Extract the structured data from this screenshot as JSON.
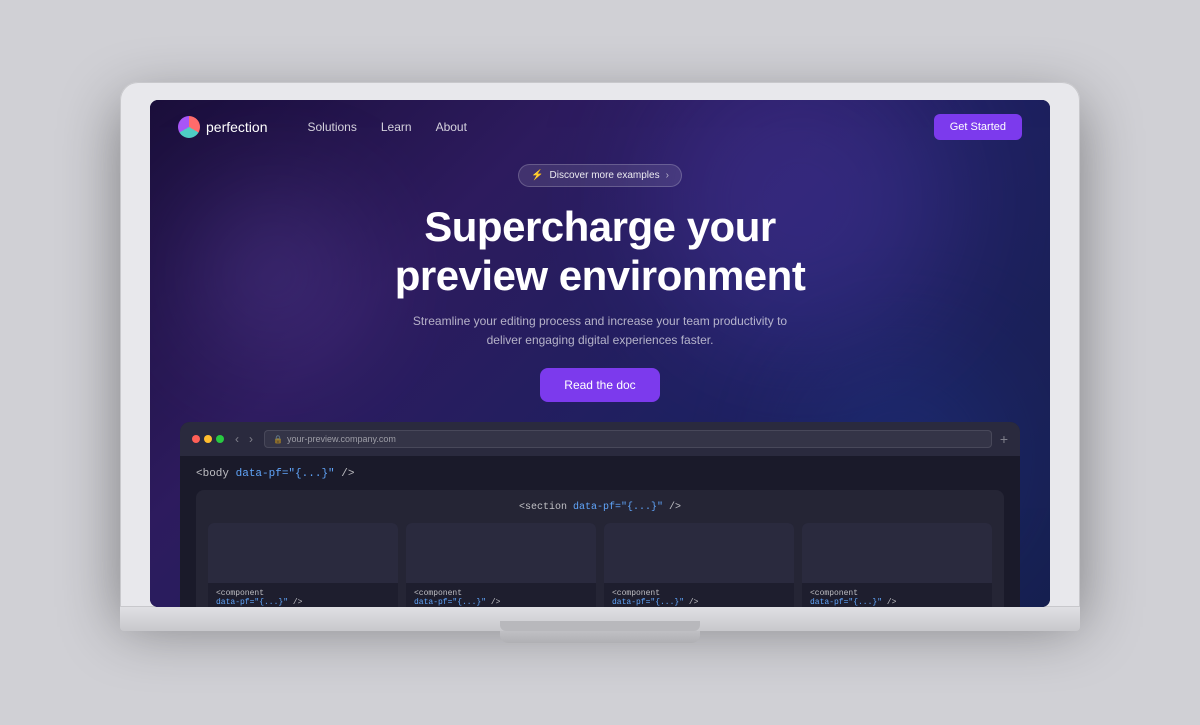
{
  "laptop": {
    "alt": "MacBook laptop showing Perfection website"
  },
  "website": {
    "nav": {
      "logo_text": "perfection",
      "links": [
        {
          "label": "Solutions",
          "href": "#"
        },
        {
          "label": "Learn",
          "href": "#"
        },
        {
          "label": "About",
          "href": "#"
        }
      ],
      "cta_label": "Get Started"
    },
    "hero": {
      "badge_text": "Discover more examples",
      "badge_icon": "⚡",
      "badge_chevron": "›",
      "title_line1": "Supercharge your",
      "title_line2": "preview environment",
      "subtitle": "Streamline your editing process and increase your team productivity to deliver engaging digital experiences faster.",
      "cta_label": "Read the doc"
    },
    "browser": {
      "url": "your-preview.company.com",
      "back_btn": "‹",
      "forward_btn": "›",
      "add_btn": "+",
      "code": {
        "body_tag": "<body",
        "body_attr": "data-pf=\"{...}\"",
        "body_close": "/>",
        "section_tag": "<section",
        "section_attr": "data-pf=\"{...}\"",
        "section_close": "/>"
      },
      "components": [
        {
          "tag": "<component",
          "attr": "data-pf=\"{...}\"",
          "close": "/>"
        },
        {
          "tag": "<component",
          "attr": "data-pf=\"{...}\"",
          "close": "/>"
        },
        {
          "tag": "<component",
          "attr": "data-pf=\"{...}\"",
          "close": "/>"
        },
        {
          "tag": "<component",
          "attr": "data-pf=\"{...}\"",
          "close": "/>"
        }
      ]
    }
  },
  "colors": {
    "accent_purple": "#7c3aed",
    "code_blue": "#60a5fa",
    "code_pink": "#f472b6",
    "logo_gradient_start": "#ff6b6b",
    "logo_gradient_mid": "#4ecdc4",
    "logo_gradient_end": "#a855f7"
  }
}
